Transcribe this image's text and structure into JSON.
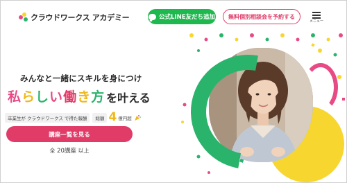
{
  "brand": {
    "name": "クラウドワークス アカデミー",
    "colors": {
      "primary": "#e13b68",
      "green": "#2ab36b",
      "yellow": "#f7d630",
      "pink": "#e84a86",
      "line_green": "#1fb84f"
    }
  },
  "header": {
    "line_button": {
      "label": "公式LINE友だち追加",
      "icon": "line-icon"
    },
    "consult_button": {
      "label": "無料個別相談会を予約する"
    },
    "menu": {
      "label": "メニュー",
      "icon": "hamburger-icon"
    }
  },
  "hero": {
    "subtitle": "みんなと一緒にスキルを身につけ",
    "headline_colored": "私らしい働き方",
    "headline_rest": "を叶える",
    "stat": {
      "left_label": "卒業生が クラウドワークス で得た報酬",
      "total_label": "総額",
      "value": "4",
      "unit": "億円超"
    },
    "cta_label": "講座一覧を見る",
    "course_count_prefix": "全",
    "course_count_value": "20講座",
    "course_count_suffix": "以上"
  }
}
